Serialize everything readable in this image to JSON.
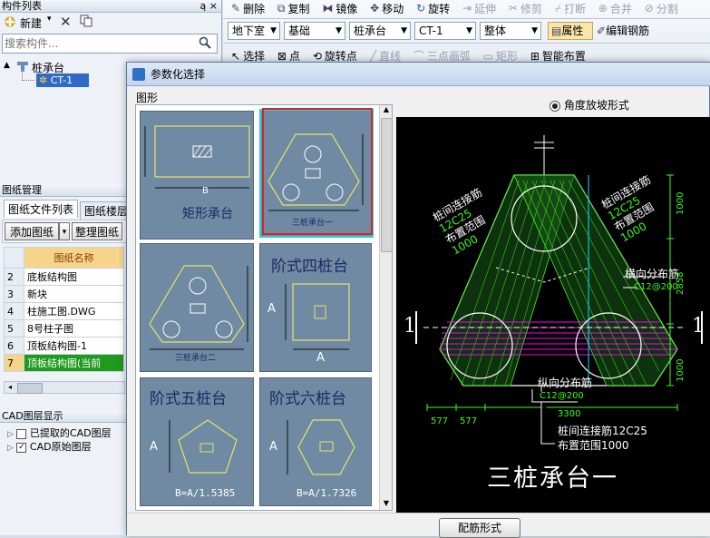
{
  "left_panel": {
    "component_list": {
      "title": "构件列表",
      "pin": "ą ×",
      "new_label": "新建",
      "search_placeholder": "搜索构件...",
      "tree_parent": "桩承台",
      "tree_child": "CT-1"
    },
    "drawing_mgmt": {
      "title": "图纸管理",
      "tabs": [
        "图纸文件列表",
        "图纸楼层"
      ],
      "add_label": "添加图纸",
      "organize_label": "整理图纸",
      "column_header": "图纸名称",
      "rows": [
        {
          "num": "2",
          "name": "底板结构图"
        },
        {
          "num": "3",
          "name": "新块"
        },
        {
          "num": "4",
          "name": "柱施工图.DWG"
        },
        {
          "num": "5",
          "name": "8号柱子图"
        },
        {
          "num": "6",
          "name": "顶板结构图-1"
        },
        {
          "num": "7",
          "name": "顶板结构图(当前"
        }
      ]
    },
    "cad_layers": {
      "title": "CAD图层显示",
      "items": [
        {
          "label": "已提取的CAD图层",
          "checked": false
        },
        {
          "label": "CAD原始图层",
          "checked": true
        }
      ]
    }
  },
  "toolbar": {
    "row1": [
      "删除",
      "复制",
      "镜像",
      "移动",
      "旋转",
      "延伸",
      "修剪",
      "打断",
      "合并",
      "分割"
    ],
    "combos": [
      "地下室",
      "基础",
      "桩承台",
      "CT-1",
      "整体"
    ],
    "props_label": "属性",
    "edit_rebar_label": "编辑钢筋",
    "row3": [
      "选择",
      "点",
      "旋转点",
      "直线",
      "三点画弧",
      "矩形",
      "智能布置"
    ]
  },
  "dialog": {
    "title": "参数化选择",
    "group_label": "图形",
    "radio_label": "角度放坡形式",
    "config_button": "配筋形式",
    "thumbnails": [
      {
        "caption": "矩形承台",
        "dim": "B"
      },
      {
        "caption": "三桩承台一",
        "selected": true
      },
      {
        "caption": "三桩承台二"
      },
      {
        "caption": "阶式四桩台",
        "dim_a": "A",
        "dim_b": "A"
      },
      {
        "caption": "阶式五桩台",
        "dim_a": "A",
        "formula": "B=A/1.5385"
      },
      {
        "caption": "阶式六桩台",
        "dim_a": "A",
        "formula": "B=A/1.7326"
      }
    ],
    "preview": {
      "title": "三桩承台一",
      "section_mark": "1",
      "left_label_1": "桩间连接筋",
      "left_label_2": "12C25",
      "left_label_3": "布置范围",
      "left_label_4": "1000",
      "right_label_1": "桩间连接筋",
      "right_label_2": "12C25",
      "right_label_3": "布置范围",
      "right_label_4": "1000",
      "transverse_label": "横向分布筋",
      "transverse_value": "C12@200",
      "longitudinal_label": "纵向分布筋",
      "longitudinal_value": "C12@200",
      "bottom_note_1": "桩间连接筋12C25",
      "bottom_note_2": "布置范围1000",
      "dim_top": "1000",
      "dim_mid": "2858",
      "dim_bottom": "1000",
      "dim_width": "3300",
      "dim_577a": "577",
      "dim_577b": "577"
    }
  },
  "colors": {
    "accent": "#316ac5",
    "selected_border": "#e02020",
    "cad_bg": "#000000",
    "cad_green": "#39ff14",
    "cad_magenta": "#ff00ff",
    "cad_cyan": "#00e5ff",
    "thumb_bg": "#6f8aa2"
  }
}
